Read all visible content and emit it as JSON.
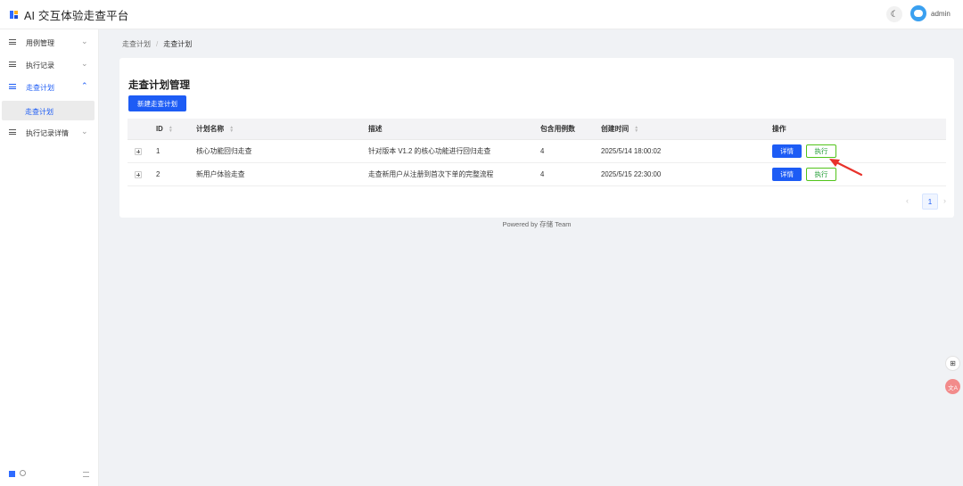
{
  "app": {
    "title": "AI 交互体验走查平台",
    "username": "admin",
    "accent_color": "#1d5cf5"
  },
  "header": {
    "theme_icon": "moon-icon",
    "theme_glyph": "☾"
  },
  "sidebar": {
    "items": [
      {
        "label": "用例管理",
        "chevron": "⌄"
      },
      {
        "label": "执行记录",
        "chevron": "⌄"
      },
      {
        "label": "走查计划",
        "chevron": "⌃"
      },
      {
        "label": "执行记录详情",
        "chevron": "⌄"
      }
    ],
    "submenu": {
      "label": "走查计划"
    }
  },
  "breadcrumb": {
    "items": [
      "走查计划",
      "走查计划"
    ],
    "separator": "/"
  },
  "main": {
    "title": "走查计划管理",
    "new_button": "新建走查计划",
    "table": {
      "headers": {
        "id": "ID",
        "name": "计划名称",
        "desc": "描述",
        "count": "包含用例数",
        "created": "创建时间",
        "actions": "操作"
      },
      "rows": [
        {
          "id": "1",
          "name": "核心功能回归走查",
          "desc": "针对版本 V1.2 的核心功能进行回归走查",
          "count": "4",
          "created": "2025/5/14 18:00:02",
          "detail": "详情",
          "exec": "执行"
        },
        {
          "id": "2",
          "name": "新用户体验走查",
          "desc": "走查新用户从注册到首次下单的完整流程",
          "count": "4",
          "created": "2025/5/15 22:30:00",
          "detail": "详情",
          "exec": "执行"
        }
      ]
    },
    "pagination": {
      "current_page": "1",
      "prev": "‹",
      "next": "›"
    }
  },
  "footer": {
    "text": "Powered by 存储 Team"
  },
  "floating": {
    "grid_glyph": "⊞",
    "translate_glyph": "文A"
  }
}
